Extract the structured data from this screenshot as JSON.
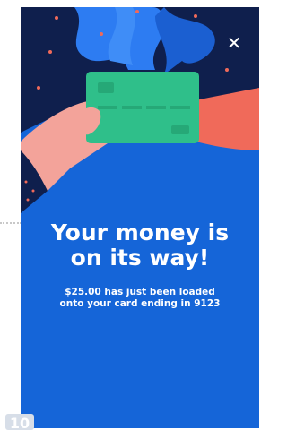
{
  "colors": {
    "background": "#1565d8",
    "dark_navy": "#0f1f4d",
    "card": "#2fbf8a",
    "sleeve_right": "#f06a5a",
    "skin": "#f3a39a",
    "accent_blue": "#2d7cf2"
  },
  "close": {
    "icon": "close-icon",
    "label": "✕"
  },
  "message": {
    "title_line1": "Your money is",
    "title_line2": "on its way!",
    "subtitle_line1": "$25.00 has just been loaded",
    "subtitle_line2": "onto your card ending in 9123"
  },
  "page_badge": {
    "label": "10"
  }
}
